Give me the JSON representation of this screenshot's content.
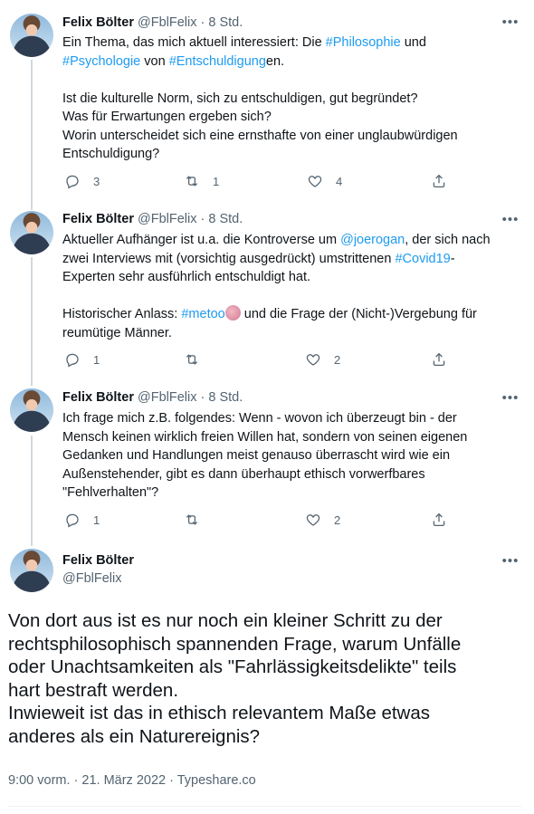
{
  "tweets": [
    {
      "name": "Felix Bölter",
      "handle": "@FblFelix",
      "sep": "·",
      "time": "8 Std.",
      "more": "•••",
      "line1_a": "Ein Thema, das mich aktuell interessiert: Die ",
      "line1_link": "#Philosophie",
      "line1_b": " und",
      "line2_link1": "#Psychologie",
      "line2_a": " von ",
      "line2_link2": "#Entschuldigung",
      "line2_b": "en.",
      "line3": "Ist die kulturelle Norm, sich zu entschuldigen, gut begründet?",
      "line4": "Was für Erwartungen ergeben sich?",
      "line5": "Worin unterscheidet sich eine ernsthafte von einer unglaubwürdigen",
      "line6": "Entschuldigung?",
      "replies": "3",
      "retweets": "1",
      "likes": "4"
    },
    {
      "name": "Felix Bölter",
      "handle": "@FblFelix",
      "sep": "·",
      "time": "8 Std.",
      "more": "•••",
      "line1_a": "Aktueller Aufhänger ist u.a. die Kontroverse um ",
      "line1_link": "@joerogan",
      "line1_b": ", der sich nach",
      "line2_a": "zwei Interviews mit (vorsichtig ausgedrückt) umstrittenen ",
      "line2_link": "#Covid19",
      "line2_b": "-",
      "line3": "Experten sehr ausführlich entschuldigt hat.",
      "line4_a": "Historischer Anlass: ",
      "line4_link": "#metoo",
      "line4_b": " und die Frage der (Nicht-)Vergebung für",
      "line5": "reumütige Männer.",
      "replies": "1",
      "retweets": "",
      "likes": "2"
    },
    {
      "name": "Felix Bölter",
      "handle": "@FblFelix",
      "sep": "·",
      "time": "8 Std.",
      "more": "•••",
      "line1": "Ich frage mich z.B. folgendes: Wenn - wovon ich überzeugt bin - der",
      "line2": "Mensch keinen wirklich freien Willen hat, sondern von seinen eigenen",
      "line3": "Gedanken und Handlungen meist genauso überrascht wird wie ein",
      "line4": "Außenstehender, gibt es dann überhaupt ethisch vorwerfbares",
      "line5": "\"Fehlverhalten\"?",
      "replies": "1",
      "retweets": "",
      "likes": "2"
    }
  ],
  "main": {
    "name": "Felix Bölter",
    "handle": "@FblFelix",
    "more": "•••",
    "line1": "Von dort aus ist es nur noch ein kleiner Schritt zu der",
    "line2": "rechtsphilosophisch spannenden Frage, warum Unfälle",
    "line3": "oder Unachtsamkeiten als \"Fahrlässigkeitsdelikte\" teils",
    "line4": "hart bestraft werden.",
    "line5": "Inwieweit ist das in ethisch relevantem Maße etwas",
    "line6": "anderes als ein Naturereignis?",
    "timestamp": "9:00 vorm. · 21. März 2022 · Typeshare.co"
  }
}
